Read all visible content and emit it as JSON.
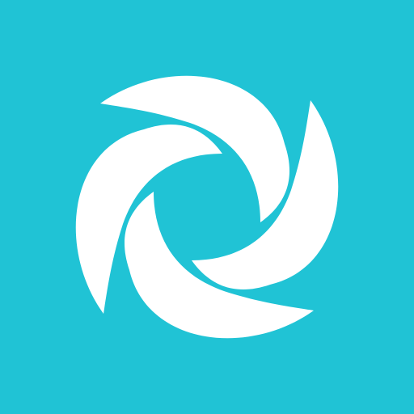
{
  "app_icon": {
    "icon": "swirl-logo-icon",
    "colors": {
      "background": "#20C3D5",
      "foreground": "#FFFFFF"
    }
  }
}
